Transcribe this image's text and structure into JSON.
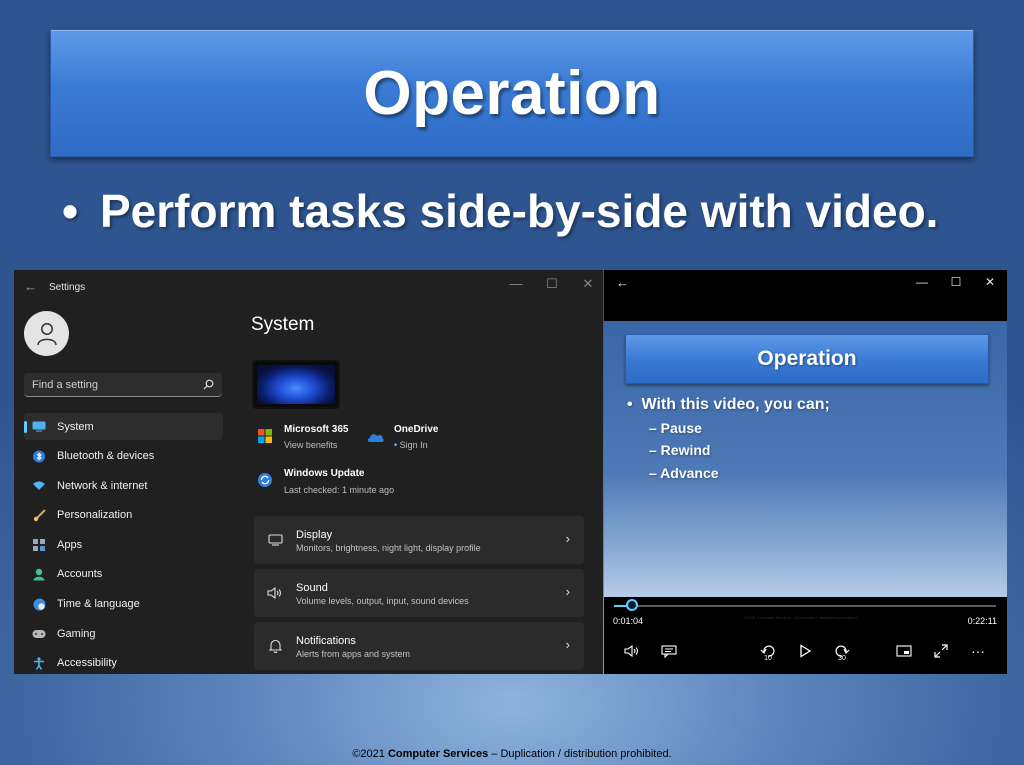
{
  "slide": {
    "title": "Operation",
    "bullet": "Perform tasks side-by-side with video.",
    "footer": {
      "prefix": "©2021 ",
      "company": "Computer Services",
      "suffix": " – Duplication / distribution prohibited."
    }
  },
  "settings": {
    "app_title": "Settings",
    "search_placeholder": "Find a setting",
    "page_title": "System",
    "nav": [
      {
        "label": "System",
        "icon": "system-icon",
        "active": true
      },
      {
        "label": "Bluetooth & devices",
        "icon": "bluetooth-icon"
      },
      {
        "label": "Network & internet",
        "icon": "wifi-icon"
      },
      {
        "label": "Personalization",
        "icon": "brush-icon"
      },
      {
        "label": "Apps",
        "icon": "apps-icon"
      },
      {
        "label": "Accounts",
        "icon": "accounts-icon"
      },
      {
        "label": "Time & language",
        "icon": "globe-clock-icon"
      },
      {
        "label": "Gaming",
        "icon": "gamepad-icon"
      },
      {
        "label": "Accessibility",
        "icon": "accessibility-icon"
      }
    ],
    "quick": {
      "m365": {
        "title": "Microsoft 365",
        "sub": "View benefits"
      },
      "onedrive": {
        "title": "OneDrive",
        "sub": "Sign In"
      },
      "update": {
        "title": "Windows Update",
        "sub": "Last checked: 1 minute ago"
      }
    },
    "cards": [
      {
        "title": "Display",
        "sub": "Monitors, brightness, night light, display profile",
        "icon": "monitor-icon"
      },
      {
        "title": "Sound",
        "sub": "Volume levels, output, input, sound devices",
        "icon": "speaker-icon"
      },
      {
        "title": "Notifications",
        "sub": "Alerts from apps and system",
        "icon": "bell-icon"
      }
    ]
  },
  "video": {
    "title": "Operation",
    "bullet": "With this video, you can;",
    "subs": [
      "– Pause",
      "– Rewind",
      "– Advance"
    ],
    "copyright": "©2021 Computer Services – Duplication / distribution prohibited.",
    "time_elapsed": "0:01:04",
    "time_total": "0:22:11",
    "progress": 0.048,
    "skip_back": "10",
    "skip_fwd": "30"
  },
  "colors": {
    "accent": "#60cdff",
    "title_blue": "#3a7bd5"
  }
}
